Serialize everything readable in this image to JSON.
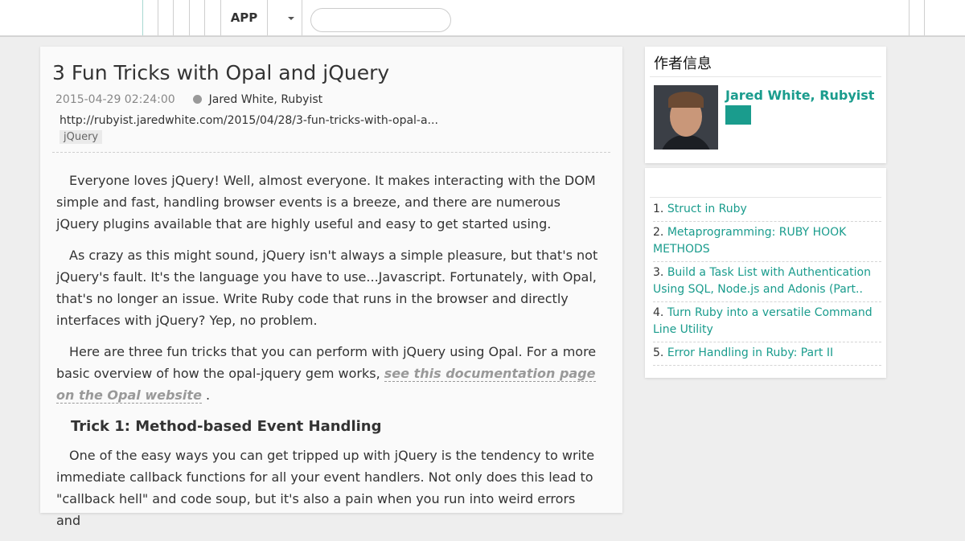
{
  "nav": {
    "app_label": "APP",
    "search_placeholder": ""
  },
  "article": {
    "title": "3 Fun Tricks with Opal and jQuery",
    "date": "2015-04-29 02:24:00",
    "author": "Jared White, Rubyist",
    "source_url": "http://rubyist.jaredwhite.com/2015/04/28/3-fun-tricks-with-opal-a...",
    "tag": "jQuery",
    "p1": "Everyone loves jQuery! Well, almost everyone. It makes interacting with the DOM simple and fast, handling browser events is a breeze, and there are numerous jQuery plugins available that are highly useful and easy to get started using.",
    "p2": "As crazy as this might sound, jQuery isn't always a simple pleasure, but that's not jQuery's fault. It's the language you have to use...Javascript. Fortunately, with Opal, that's no longer an issue. Write Ruby code that runs in the browser and directly interfaces with jQuery? Yep, no problem.",
    "p3_before": "Here are three fun tricks that you can perform with jQuery using Opal. For a more basic overview of how the opal-jquery gem works,",
    "p3_link": "see this documentation page on the Opal website",
    "p3_after": ".",
    "h_trick1": "Trick 1: Method-based Event Handling",
    "p4": "One of the easy ways you can get tripped up with jQuery is the tendency to write immediate callback functions for all your event handlers. Not only does this lead to \"callback hell\" and code soup, but it's also a pain when you run into weird errors and"
  },
  "author_card": {
    "heading": "作者信息",
    "name": "Jared White, Rubyist"
  },
  "related": {
    "items": [
      {
        "num": "1.",
        "title": "Struct in Ruby"
      },
      {
        "num": "2.",
        "title": "Metaprogramming: RUBY HOOK METHODS"
      },
      {
        "num": "3.",
        "title": "Build a Task List with Authentication Using SQL, Node.js and Adonis (Part.."
      },
      {
        "num": "4.",
        "title": "Turn Ruby into a versatile Command Line Utility"
      },
      {
        "num": "5.",
        "title": "Error Handling in Ruby: Part II"
      }
    ]
  },
  "colors": {
    "accent": "#1a9c8d",
    "background": "#eeeeee"
  }
}
